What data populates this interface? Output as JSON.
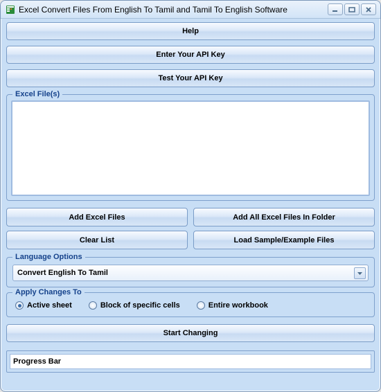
{
  "window": {
    "title": "Excel Convert Files From English To Tamil and Tamil To English Software"
  },
  "buttons": {
    "help": "Help",
    "enter_api": "Enter Your API Key",
    "test_api": "Test Your API Key",
    "add_files": "Add Excel Files",
    "add_folder": "Add All Excel Files In Folder",
    "clear_list": "Clear List",
    "load_sample": "Load Sample/Example Files",
    "start": "Start Changing"
  },
  "labels": {
    "files_group": "Excel File(s)",
    "language_options": "Language Options",
    "apply_changes": "Apply Changes To",
    "progress": "Progress Bar"
  },
  "language": {
    "selected": "Convert English To Tamil"
  },
  "radios": {
    "active_sheet": "Active sheet",
    "block_cells": "Block of specific cells",
    "entire_workbook": "Entire workbook"
  }
}
